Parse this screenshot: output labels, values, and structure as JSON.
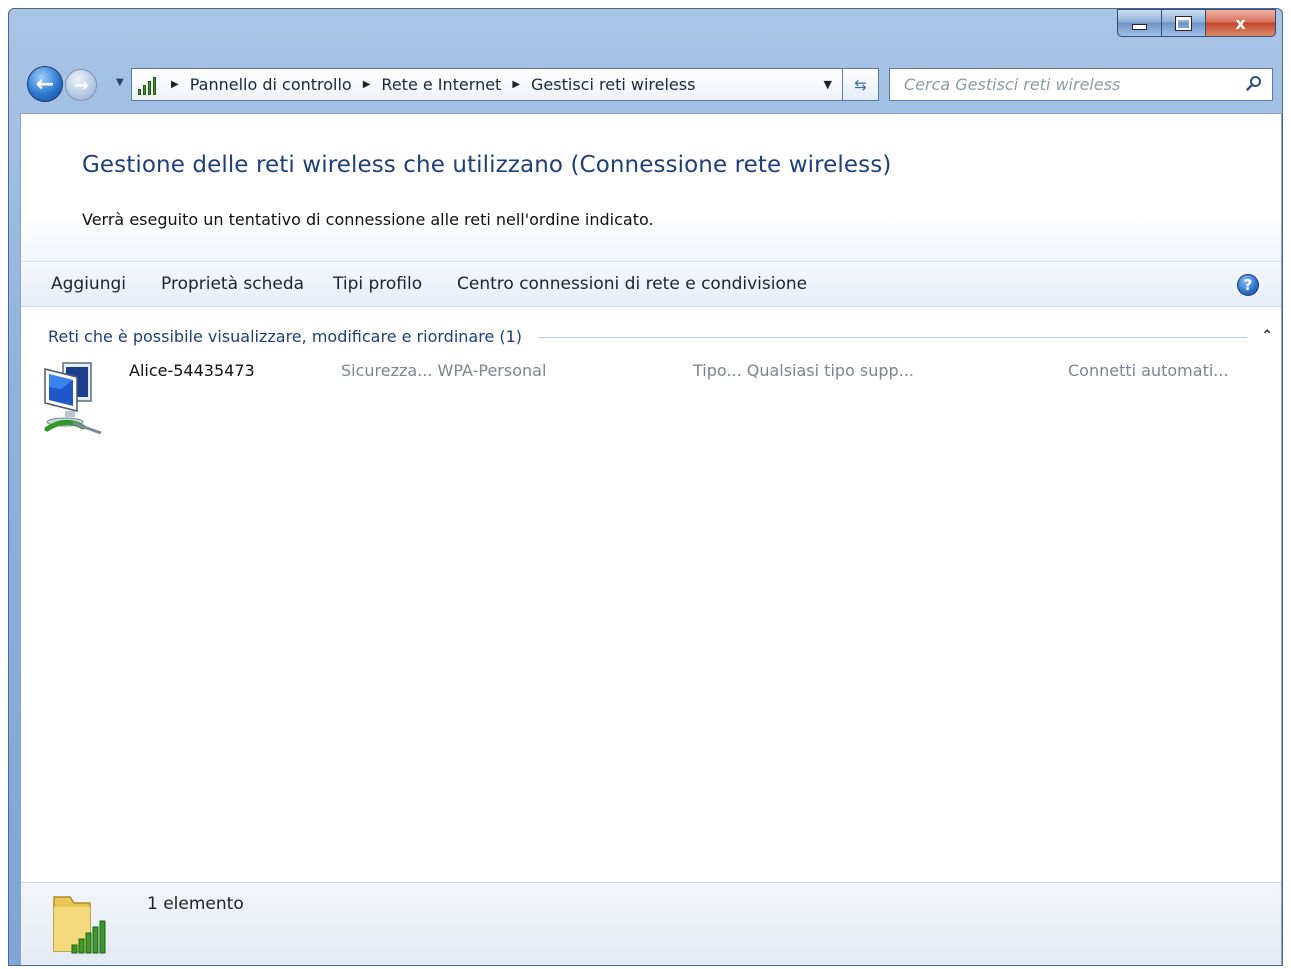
{
  "window": {
    "caption": {
      "minimize": "minimize",
      "maximize": "maximize",
      "close": "x"
    }
  },
  "nav": {
    "breadcrumbs": [
      "Pannello di controllo",
      "Rete e Internet",
      "Gestisci reti wireless"
    ],
    "search_placeholder": "Cerca Gestisci reti wireless"
  },
  "header": {
    "title": "Gestione delle reti wireless che utilizzano (Connessione rete wireless)",
    "subtitle": "Verrà eseguito un tentativo di connessione alle reti nell'ordine indicato."
  },
  "toolbar": {
    "items": [
      "Aggiungi",
      "Proprietà scheda",
      "Tipi profilo",
      "Centro connessioni di rete e condivisione"
    ],
    "help_label": "?"
  },
  "group": {
    "title": "Reti che è possibile visualizzare, modificare e riordinare (1)"
  },
  "networks": [
    {
      "name": "Alice-54435473",
      "security": "Sicurezza... WPA-Personal",
      "type": "Tipo... Qualsiasi tipo supp...",
      "mode": "Connetti automati..."
    }
  ],
  "status": {
    "count_text": "1 elemento"
  },
  "colors": {
    "title_blue": "#1e3f7a",
    "accent": "#2b77cf",
    "signal_green": "#3c9a2c"
  },
  "icons": [
    "back-arrow-icon",
    "forward-arrow-icon",
    "network-signal-icon",
    "refresh-icon",
    "search-icon",
    "help-icon",
    "wireless-network-icon",
    "folder-signal-icon",
    "collapse-chevron-icon"
  ]
}
